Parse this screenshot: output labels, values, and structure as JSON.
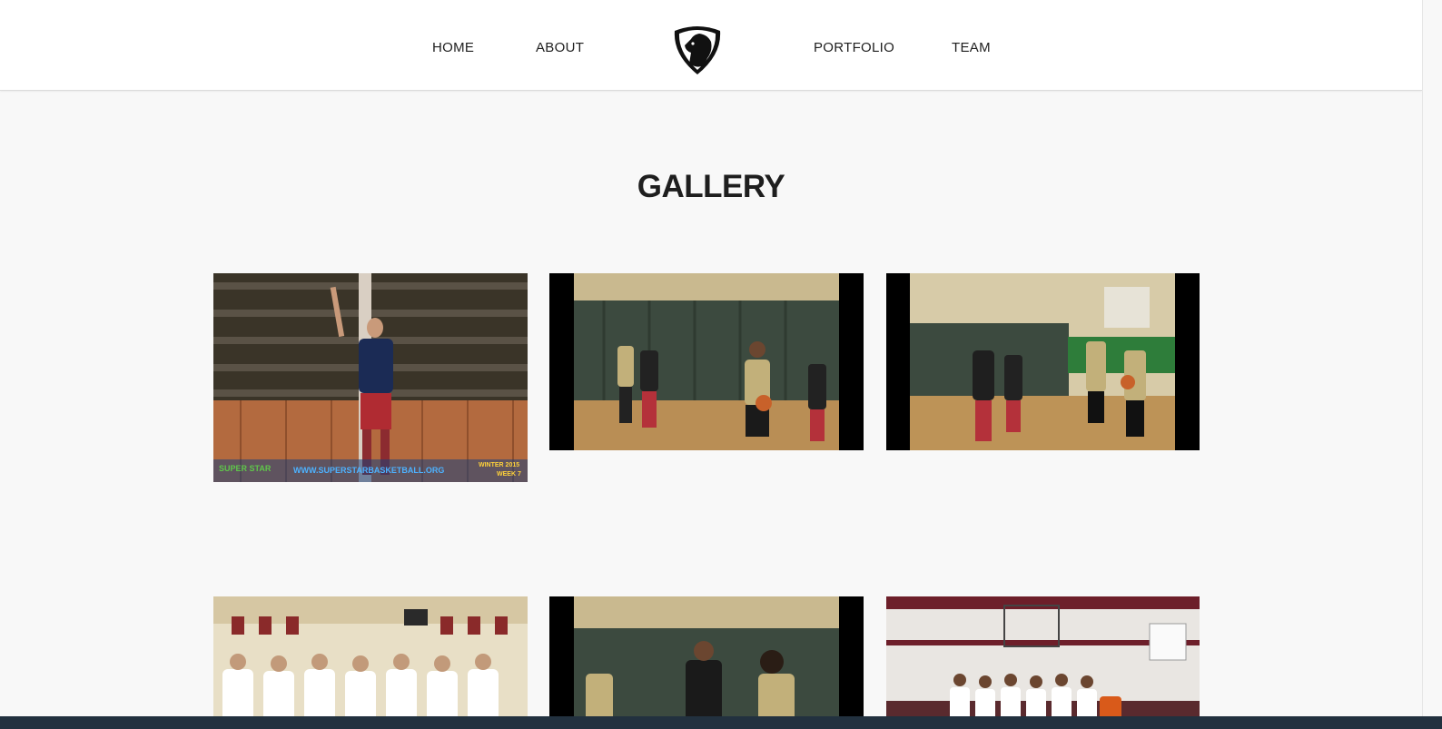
{
  "nav": {
    "links": [
      {
        "label": "HOME"
      },
      {
        "label": "ABOUT"
      },
      {
        "label": "PORTFOLIO"
      },
      {
        "label": "TEAM"
      }
    ],
    "logo_icon": "horse-head-shield-icon"
  },
  "gallery": {
    "title": "GALLERY",
    "photos": [
      {
        "subject": "Player in #21 jersey shooting follow-through in gym bleachers",
        "overlay_left": "SUPER STAR",
        "overlay_url": "WWW.SUPERSTARBASKETBALL.ORG",
        "overlay_right_1": "WINTER 2015",
        "overlay_right_2": "WEEK 7"
      },
      {
        "subject": "Player driving with basketball in gym with green curtain"
      },
      {
        "subject": "Players in black and gold jerseys on court"
      },
      {
        "subject": "Team group photo in white shirts"
      },
      {
        "subject": "Player in TCL jersey number 0 guarding opponent number 22"
      },
      {
        "subject": "Team lined up under basketball hoop"
      }
    ]
  },
  "colors": {
    "background": "#f8f8f8",
    "nav_background": "#ffffff",
    "text": "#1e1e1e",
    "bottom_bar": "#22313f"
  }
}
